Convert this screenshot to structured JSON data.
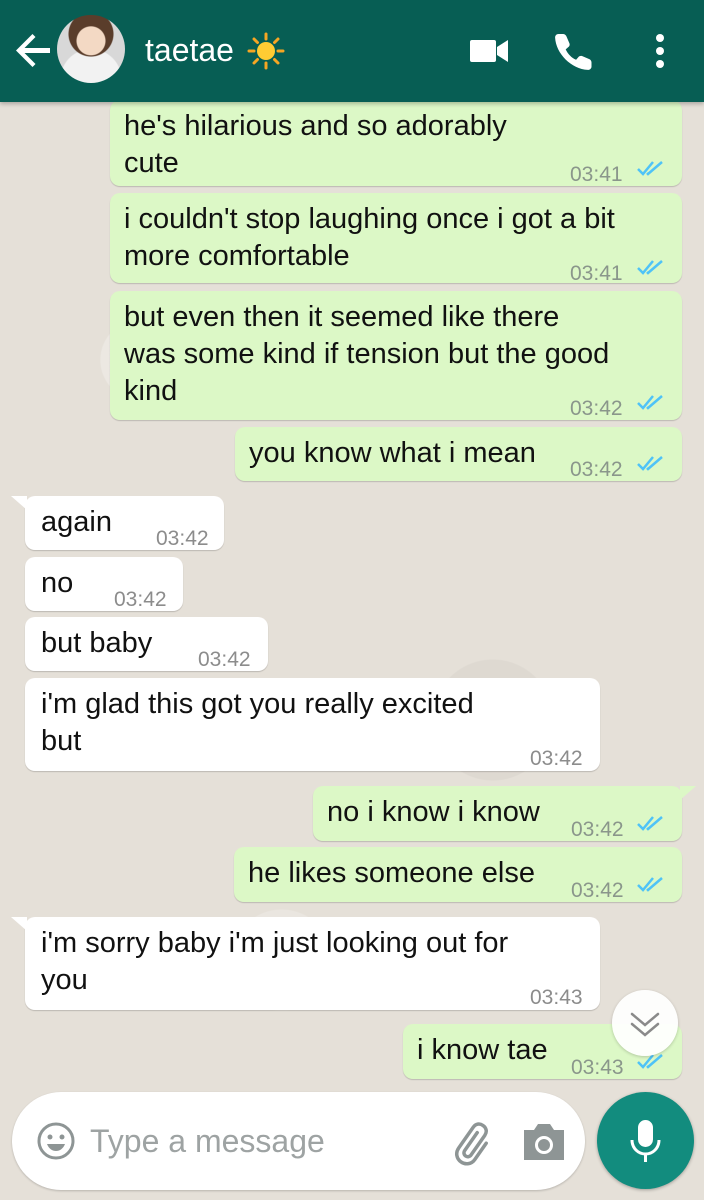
{
  "header": {
    "contact_name": "taetae",
    "icons": [
      "back-arrow-icon",
      "avatar",
      "sun-emoji",
      "video-call-icon",
      "phone-icon",
      "more-vert-icon"
    ]
  },
  "messages": [
    {
      "direction": "out",
      "text": "he's hilarious and so adorably\ncute",
      "time": "03:41",
      "status": "read"
    },
    {
      "direction": "out",
      "text": "i couldn't stop laughing once i got a bit\nmore comfortable",
      "time": "03:41",
      "status": "read"
    },
    {
      "direction": "out",
      "text": "but even then it seemed like there\nwas some kind if tension but the good\nkind",
      "time": "03:42",
      "status": "read"
    },
    {
      "direction": "out",
      "text": "you know what i mean",
      "time": "03:42",
      "status": "read"
    },
    {
      "direction": "in",
      "text": "again",
      "time": "03:42"
    },
    {
      "direction": "in",
      "text": "no",
      "time": "03:42"
    },
    {
      "direction": "in",
      "text": "but baby",
      "time": "03:42"
    },
    {
      "direction": "in",
      "text": "i'm glad this got you really excited\nbut",
      "time": "03:42"
    },
    {
      "direction": "out",
      "text": "no i know i know",
      "time": "03:42",
      "status": "read"
    },
    {
      "direction": "out",
      "text": "he likes someone else",
      "time": "03:42",
      "status": "read"
    },
    {
      "direction": "in",
      "text": "i'm sorry baby i'm just looking out for\nyou",
      "time": "03:43"
    },
    {
      "direction": "out",
      "text": "i know tae",
      "time": "03:43",
      "status": "read"
    }
  ],
  "composer": {
    "placeholder": "Type a message"
  },
  "colors": {
    "header": "#075e54",
    "outgoing_bubble": "#dcf8c6",
    "incoming_bubble": "#ffffff",
    "read_ticks": "#4fc3f7",
    "mic_button": "#128c7e"
  }
}
